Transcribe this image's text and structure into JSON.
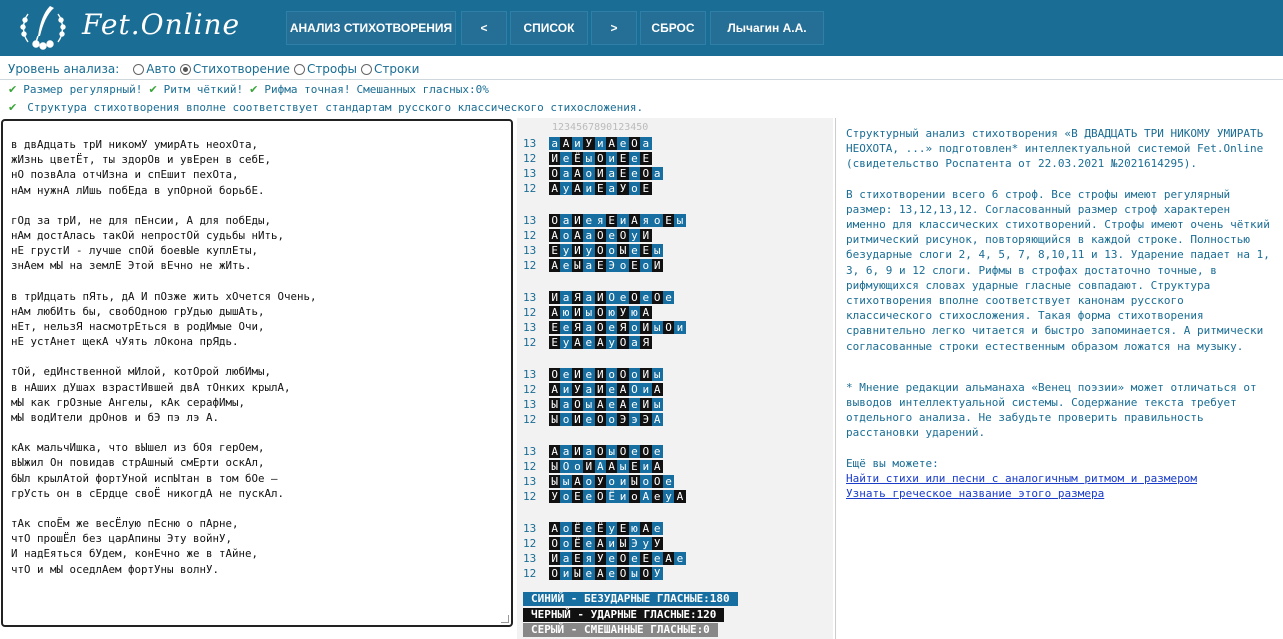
{
  "header": {
    "brand": "Fet.Online",
    "nav": [
      {
        "label": "АНАЛИЗ СТИХОТВОРЕНИЯ"
      },
      {
        "label": "<"
      },
      {
        "label": "СПИСОК"
      },
      {
        "label": ">"
      },
      {
        "label": "СБРОС"
      },
      {
        "label": "Лычагин А.А."
      }
    ]
  },
  "level": {
    "label": "Уровень анализа:",
    "options": [
      {
        "label": "Авто",
        "selected": false
      },
      {
        "label": "Стихотворение",
        "selected": true
      },
      {
        "label": "Строфы",
        "selected": false
      },
      {
        "label": "Строки",
        "selected": false
      }
    ]
  },
  "status": {
    "line1": [
      "Размер регулярный!",
      "Ритм чёткий!",
      "Рифма точная!",
      "Смешанных гласных:0%"
    ],
    "line2": "Структура стихотворения вполне соответствует стандартам русского классического стихосложения."
  },
  "poem": {
    "stanzas": [
      [
        "в двАдцать трИ никомУ умирАть неохОта,",
        "жИзнь цветЁт, ты здорОв и увЕрен в себЕ,",
        "нО позвАла отчИзна и спЕшит пехОта,",
        "нАм нужнА лИшь побЕда в упОрной борьбЕ."
      ],
      [
        "гОд за трИ, не для пЕнсии, А для побЕды,",
        "нАм достАлась такОй непростОй судьбы нИть,",
        "нЕ грустИ - лучше спОй боевЫе куплЕты,",
        "знАем мЫ на землЕ Этой вЕчно не жИть."
      ],
      [
        "в трИдцать пЯть, дА И пОзже жить хОчется Очень,",
        "нАм любИть бы, свобОдною грУдью дышАть,",
        "нЕт, нельзЯ насмотрЕться в родИмые Очи,",
        "нЕ устАнет щекА чУять лОкона прЯдь."
      ],
      [
        "тОй, едИнственной мИлой, котОрой любИмы,",
        "в нАших дУшах взрастИвшей двА тОнких крылА,",
        "мЫ как грОзные Ангелы, кАк серафИмы,",
        "мЫ водИтели дрОнов и бЭ пэ лэ А."
      ],
      [
        "кАк мальчИшка, что вЫшел из бОя герОем,",
        "вЫжил Он повидав стрАшный смЕрти оскАл,",
        "бЫл крылАтой фортУной испЫтан в том бОе –",
        "грУсть он в сЕрдце своЁ никогдА не пускАл."
      ],
      [
        "тАк споЁм же весЁлую пЕсню о пАрне,",
        "чтО прошЁл без царАпины Эту войнУ,",
        "И надЕяться бУдем, конЕчно же в тАйне,",
        "чтО и мЫ оседлАем фортУны волнУ."
      ]
    ]
  },
  "analysis": {
    "ruler": "1234567890123450",
    "stanzas": [
      {
        "counts": [
          13,
          12,
          13,
          12
        ],
        "rows": [
          [
            "u:а",
            "s:А",
            "u:и",
            "s:У",
            "u:и",
            "s:А",
            "u:е",
            "s:О",
            "u:а"
          ],
          [
            "s:И",
            "u:е",
            "s:Ё",
            "u:ы",
            "s:О",
            "u:и",
            "s:Е",
            "u:е",
            "s:Е"
          ],
          [
            "s:О",
            "u:а",
            "s:А",
            "u:о",
            "s:И",
            "u:а",
            "s:Е",
            "u:е",
            "s:О",
            "u:а"
          ],
          [
            "s:А",
            "u:у",
            "s:А",
            "u:и",
            "s:Е",
            "u:а",
            "s:У",
            "u:о",
            "s:Е"
          ]
        ]
      },
      {
        "counts": [
          13,
          12,
          13,
          12
        ],
        "rows": [
          [
            "s:О",
            "u:а",
            "s:И",
            "u:е",
            "u:я",
            "s:Е",
            "u:и",
            "s:А",
            "u:я",
            "u:о",
            "s:Е",
            "u:ы"
          ],
          [
            "s:А",
            "u:о",
            "s:А",
            "u:а",
            "s:О",
            "u:е",
            "s:О",
            "u:у",
            "s:И"
          ],
          [
            "s:Е",
            "u:у",
            "s:И",
            "u:у",
            "s:О",
            "u:о",
            "s:Ы",
            "u:е",
            "s:Е",
            "u:ы"
          ],
          [
            "s:А",
            "u:е",
            "s:Ы",
            "u:а",
            "s:Е",
            "u:Э",
            "u:о",
            "s:Е",
            "u:о",
            "s:И"
          ]
        ]
      },
      {
        "counts": [
          13,
          12,
          13,
          12
        ],
        "rows": [
          [
            "s:И",
            "u:а",
            "s:Я",
            "u:а",
            "s:И",
            "u:О",
            "u:е",
            "s:О",
            "u:е",
            "s:О",
            "u:е"
          ],
          [
            "s:А",
            "u:ю",
            "s:И",
            "u:ы",
            "s:О",
            "u:ю",
            "s:У",
            "u:ю",
            "s:А"
          ],
          [
            "s:Е",
            "u:е",
            "s:Я",
            "u:а",
            "s:О",
            "u:е",
            "s:Я",
            "u:о",
            "s:И",
            "u:ы",
            "s:О",
            "u:и"
          ],
          [
            "s:Е",
            "u:у",
            "s:А",
            "u:е",
            "s:А",
            "u:у",
            "s:О",
            "u:а",
            "s:Я"
          ]
        ]
      },
      {
        "counts": [
          13,
          12,
          13,
          12
        ],
        "rows": [
          [
            "s:О",
            "u:е",
            "s:И",
            "u:е",
            "s:И",
            "u:о",
            "s:О",
            "u:о",
            "s:И",
            "u:ы"
          ],
          [
            "s:А",
            "u:и",
            "s:У",
            "u:а",
            "s:И",
            "u:е",
            "s:А",
            "u:О",
            "u:и",
            "s:А"
          ],
          [
            "s:Ы",
            "u:а",
            "s:О",
            "u:ы",
            "s:А",
            "u:е",
            "s:А",
            "u:е",
            "s:И",
            "u:ы"
          ],
          [
            "s:Ы",
            "u:о",
            "s:И",
            "u:е",
            "s:О",
            "u:о",
            "s:Э",
            "u:э",
            "s:Э",
            "u:А"
          ]
        ]
      },
      {
        "counts": [
          13,
          12,
          13,
          12
        ],
        "rows": [
          [
            "s:А",
            "u:а",
            "s:И",
            "u:а",
            "s:О",
            "u:ы",
            "s:О",
            "u:е",
            "s:О",
            "u:е"
          ],
          [
            "s:Ы",
            "u:О",
            "u:о",
            "s:И",
            "u:А",
            "s:А",
            "u:ы",
            "s:Е",
            "u:и",
            "s:А"
          ],
          [
            "s:Ы",
            "u:ы",
            "s:А",
            "u:о",
            "s:У",
            "u:о",
            "u:и",
            "s:Ы",
            "u:о",
            "s:О",
            "u:е"
          ],
          [
            "s:У",
            "u:о",
            "s:Е",
            "u:е",
            "s:О",
            "u:Ё",
            "u:и",
            "s:о",
            "u:А",
            "s:е",
            "u:у",
            "s:А"
          ]
        ]
      },
      {
        "counts": [
          13,
          12,
          13,
          12
        ],
        "rows": [
          [
            "s:А",
            "u:о",
            "s:Ё",
            "u:е",
            "s:Ё",
            "u:у",
            "s:Е",
            "u:ю",
            "s:А",
            "u:е"
          ],
          [
            "s:О",
            "u:о",
            "s:Ё",
            "u:е",
            "s:А",
            "u:и",
            "s:Ы",
            "u:Э",
            "u:у",
            "s:У"
          ],
          [
            "s:И",
            "u:а",
            "s:Е",
            "u:я",
            "s:У",
            "u:е",
            "s:О",
            "u:е",
            "s:Е",
            "u:е",
            "s:А",
            "u:е"
          ],
          [
            "s:О",
            "u:и",
            "s:Ы",
            "u:е",
            "s:А",
            "u:е",
            "s:О",
            "u:ы",
            "s:О",
            "u:У"
          ]
        ]
      }
    ],
    "legend": [
      {
        "text": "СИНИЙ - БЕЗУДАРНЫЕ ГЛАСНЫЕ:180",
        "color": "#176ea0"
      },
      {
        "text": "ЧЕРНЫЙ - УДАРНЫЕ ГЛАСНЫЕ:120",
        "color": "#111111"
      },
      {
        "text": "СЕРЫЙ - СМЕШАННЫЕ ГЛАСНЫЕ:0",
        "color": "#888888"
      }
    ]
  },
  "report": {
    "p1": "Структурный анализ стихотворения «В ДВАДЦАТЬ ТРИ НИКОМУ УМИРАТЬ НЕОХОТА, ...» подготовлен* интеллектуальной системой Fet.Online (свидетельство Роспатента от 22.03.2021 №2021614295).",
    "p2": "В стихотворении всего 6 строф. Все строфы имеют регулярный размер: 13,12,13,12. Согласованный размер строф характерен именно для классических стихотворений. Строфы имеют очень чёткий ритмический рисунок, повторяющийся в каждой строке. Полностью безударные слоги 2, 4, 5, 7, 8,10,11 и 13. Ударение падает на 1, 3, 6, 9 и 12 слоги. Рифмы в строфах достаточно точные, в рифмующихся словах ударные гласные совпадают. Структура стихотворения вполне соответствует канонам русского классического стихосложения. Такая форма стихотворения сравнительно легко читается и быстро запоминается. А ритмически согласованные строки естественным образом ложатся на музыку.",
    "p3": "* Мнение редакции альманаха «Венец поэзии» может отличаться от выводов интеллектуальной системы. Содержание текста требует отдельного анализа. Не забудьте проверить правильность расстановки ударений.",
    "more": "Ещё вы можете:",
    "link1": "Найти стихи или песни с аналогичным ритмом и размером",
    "link2": "Узнать греческое название этого размера"
  },
  "colors": {
    "header": "#1a6d94",
    "unstressed": "#176ea0",
    "stressed": "#111111",
    "mixed": "#888888",
    "text": "#1a6d94",
    "link": "#1a3cc8"
  }
}
